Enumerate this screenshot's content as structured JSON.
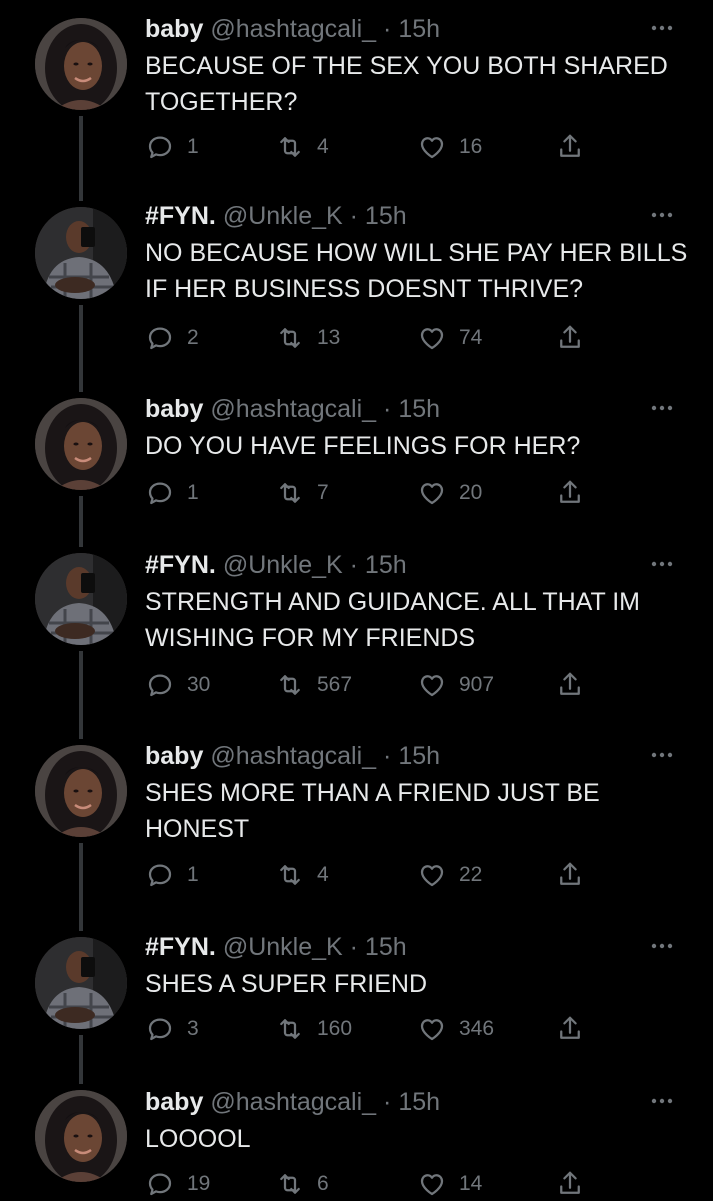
{
  "tweets": [
    {
      "user": "baby",
      "handle": "@hashtagcali_",
      "time": "15h",
      "text": "BECAUSE OF THE SEX YOU BOTH SHARED TOGETHER?",
      "replies": "1",
      "retweets": "4",
      "likes": "16",
      "avatar": "woman-avatar"
    },
    {
      "user": "#FYN.",
      "handle": "@Unkle_K",
      "time": "15h",
      "text": "NO BECAUSE HOW WILL SHE PAY HER BILLS IF HER BUSINESS DOESNT THRIVE?",
      "replies": "2",
      "retweets": "13",
      "likes": "74",
      "avatar": "man-avatar"
    },
    {
      "user": "baby",
      "handle": "@hashtagcali_",
      "time": "15h",
      "text": "DO YOU HAVE FEELINGS FOR HER?",
      "replies": "1",
      "retweets": "7",
      "likes": "20",
      "avatar": "woman-avatar"
    },
    {
      "user": "#FYN.",
      "handle": "@Unkle_K",
      "time": "15h",
      "text": "STRENGTH AND GUIDANCE. ALL THAT IM WISHING FOR MY FRIENDS",
      "replies": "30",
      "retweets": "567",
      "likes": "907",
      "avatar": "man-avatar"
    },
    {
      "user": "baby",
      "handle": "@hashtagcali_",
      "time": "15h",
      "text": "SHES MORE THAN A FRIEND JUST BE HONEST",
      "replies": "1",
      "retweets": "4",
      "likes": "22",
      "avatar": "woman-avatar"
    },
    {
      "user": "#FYN.",
      "handle": "@Unkle_K",
      "time": "15h",
      "text": "SHES A SUPER FRIEND",
      "replies": "3",
      "retweets": "160",
      "likes": "346",
      "avatar": "man-avatar"
    },
    {
      "user": "baby",
      "handle": "@hashtagcali_",
      "time": "15h",
      "text": "LOOOOL",
      "replies": "19",
      "retweets": "6",
      "likes": "14",
      "avatar": "woman-avatar"
    }
  ],
  "separator": "·",
  "colors": {
    "background": "#000000",
    "text": "#e7e9ea",
    "muted": "#71767b",
    "thread_line": "#333639"
  }
}
